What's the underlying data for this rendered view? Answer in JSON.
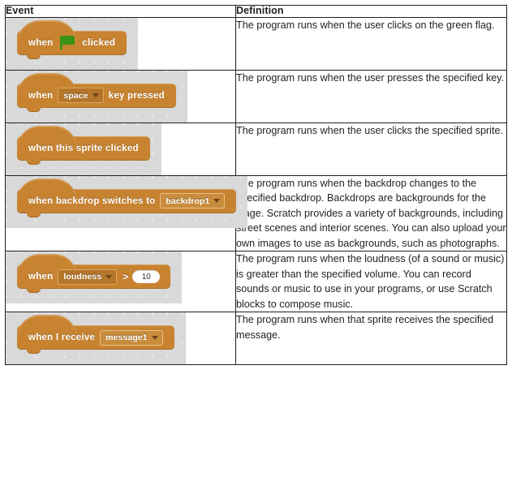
{
  "table": {
    "headers": {
      "event": "Event",
      "definition": "Definition"
    },
    "rows": [
      {
        "block": {
          "id": "when-green-flag-clicked",
          "parts": [
            {
              "type": "label",
              "text": "when"
            },
            {
              "type": "flag-icon",
              "text": ""
            },
            {
              "type": "label",
              "text": "clicked"
            }
          ]
        },
        "definition": "The program runs when the user clicks on the green flag."
      },
      {
        "block": {
          "id": "when-key-pressed",
          "parts": [
            {
              "type": "label",
              "text": "when"
            },
            {
              "type": "dropdown",
              "text": "space"
            },
            {
              "type": "label",
              "text": "key  pressed"
            }
          ]
        },
        "definition": "The program runs when the user presses the specified key."
      },
      {
        "block": {
          "id": "when-this-sprite-clicked",
          "parts": [
            {
              "type": "label",
              "text": "when  this  sprite  clicked"
            }
          ]
        },
        "definition": "The program runs when the user clicks the specified sprite."
      },
      {
        "block": {
          "id": "when-backdrop-switches-to",
          "parts": [
            {
              "type": "label",
              "text": "when  backdrop  switches  to"
            },
            {
              "type": "dropdown-light",
              "text": "backdrop1"
            }
          ]
        },
        "definition": "The program runs when the backdrop changes to the specified backdrop. Backdrops are backgrounds for the stage. Scratch provides a variety of backgrounds, including street scenes and interior scenes. You can also upload your own images to use as backgrounds, such as photographs."
      },
      {
        "block": {
          "id": "when-loudness-greater-than",
          "parts": [
            {
              "type": "label",
              "text": "when"
            },
            {
              "type": "dropdown",
              "text": "loudness"
            },
            {
              "type": "operator",
              "text": ">"
            },
            {
              "type": "number",
              "text": "10"
            }
          ]
        },
        "definition": "The program runs when the loudness (of a sound or music) is greater than the specified volume. You can record sounds or music to use in your programs, or use Scratch blocks to compose music."
      },
      {
        "block": {
          "id": "when-i-receive",
          "parts": [
            {
              "type": "label",
              "text": "when  I  receive"
            },
            {
              "type": "dropdown-light",
              "text": "message1"
            }
          ]
        },
        "definition": "The program runs when that sprite receives the specified message."
      }
    ]
  },
  "colors": {
    "block_orange": "#c88330",
    "dropdown_dark": "#b4762a",
    "dropdown_light": "#c98c3d",
    "canvas_gray": "#d9d9d9",
    "flag_green": "#3a9216",
    "border": "#231f20",
    "text": "#231f20"
  }
}
